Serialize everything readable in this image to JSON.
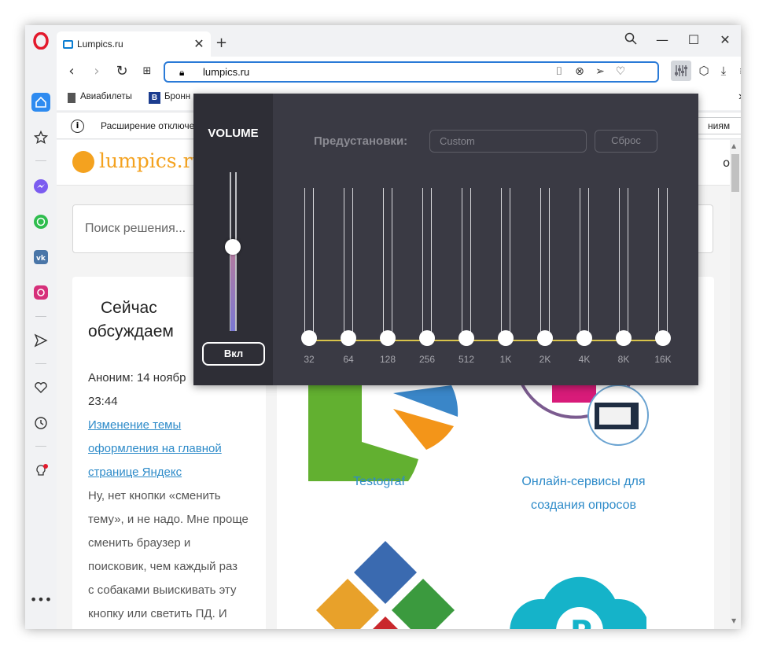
{
  "browser": {
    "tab_title": "Lumpics.ru",
    "url": "lumpics.ru",
    "new_tab": "+"
  },
  "bookmarks": [
    {
      "label": "Авиабилеты"
    },
    {
      "label": "Бронн"
    }
  ],
  "infobar": {
    "text": "Расширение отключе",
    "button": "ниям"
  },
  "site": {
    "logo": "lumpics.ru",
    "header_right": "о",
    "search_placeholder": "Поиск решения..."
  },
  "discussion": {
    "heading_line1": "Сейчас",
    "heading_line2": "обсуждаем",
    "author_line1": "Аноним: 14 ноябр",
    "author_line2": "23:44",
    "link_lines": [
      "Изменение темы",
      "оформления на главной",
      "странице Яндекс"
    ],
    "comment_lines": [
      "Ну, нет кнопки «сменить",
      "тему», и не надо. Мне проще",
      "сменить браузер и",
      "поисковик, чем каждый раз",
      "с собаками выискивать эту",
      "кнопку или светить ПД. И"
    ]
  },
  "cards": [
    {
      "caption": "Testograf"
    },
    {
      "caption_line1": "Онлайн-сервисы для",
      "caption_line2": "создания опросов"
    }
  ],
  "equalizer": {
    "volume_title": "VOLUME",
    "volume_level": 0.53,
    "power_button": "Вкл",
    "presets_label": "Предустановки:",
    "preset_value": "Custom",
    "reset_button": "Сброс",
    "bands": [
      {
        "label": "32",
        "gain": 0
      },
      {
        "label": "64",
        "gain": 0
      },
      {
        "label": "128",
        "gain": 0
      },
      {
        "label": "256",
        "gain": 0
      },
      {
        "label": "512",
        "gain": 0
      },
      {
        "label": "1K",
        "gain": 0
      },
      {
        "label": "2K",
        "gain": 0
      },
      {
        "label": "4K",
        "gain": 0
      },
      {
        "label": "8K",
        "gain": 0
      },
      {
        "label": "16K",
        "gain": 0
      }
    ]
  },
  "colors": {
    "accent": "#2a7ad7",
    "logo_orange": "#f4a21f",
    "link_blue": "#2e8bc9",
    "eq_bg": "#3a3a44",
    "eq_curve": "#d8c34a"
  }
}
